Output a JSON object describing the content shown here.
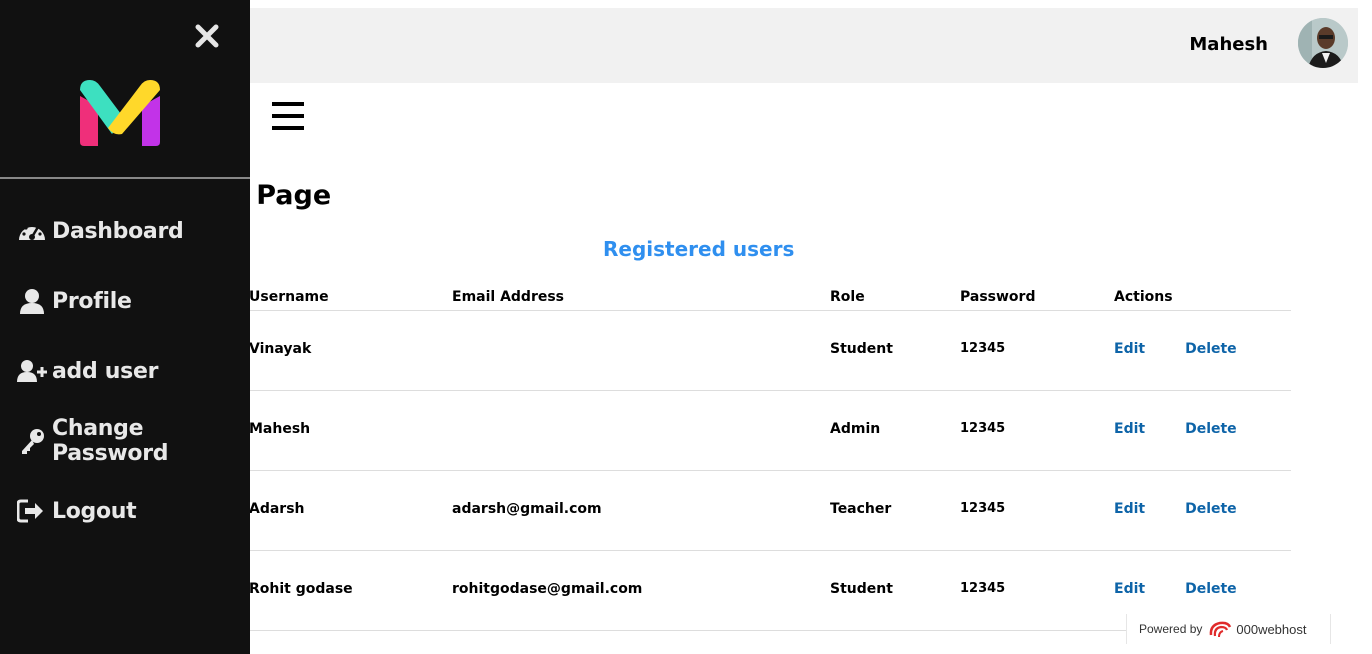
{
  "header": {
    "user_name": "Mahesh"
  },
  "main": {
    "page_title": "Admin Page",
    "table_title": "Registered users",
    "columns": [
      "Username",
      "Email Address",
      "Role",
      "Password",
      "Actions"
    ],
    "rows": [
      {
        "username": "Vinayak",
        "email": "",
        "role": "Student",
        "password": "12345",
        "edit": "Edit",
        "delete": "Delete"
      },
      {
        "username": "Mahesh",
        "email": "",
        "role": "Admin",
        "password": "12345",
        "edit": "Edit",
        "delete": "Delete"
      },
      {
        "username": "Adarsh",
        "email": "adarsh@gmail.com",
        "role": "Teacher",
        "password": "12345",
        "edit": "Edit",
        "delete": "Delete"
      },
      {
        "username": "Rohit godase",
        "email": "rohitgodase@gmail.com",
        "role": "Student",
        "password": "12345",
        "edit": "Edit",
        "delete": "Delete"
      }
    ]
  },
  "sidebar": {
    "items": [
      {
        "label": "Dashboard",
        "icon": "dashboard-gauge-icon"
      },
      {
        "label": "Profile",
        "icon": "user-icon"
      },
      {
        "label": "add user",
        "icon": "user-plus-icon"
      },
      {
        "label": "Change Password",
        "icon": "key-icon"
      },
      {
        "label": "Logout",
        "icon": "sign-out-icon"
      }
    ]
  },
  "footer": {
    "powered_by": "Powered by",
    "host_name": "000webhost"
  },
  "colors": {
    "sidebar_bg": "#111111",
    "topbar_bg": "#f1f1f1",
    "accent_title": "#2f8fef",
    "link": "#0e64a8"
  }
}
